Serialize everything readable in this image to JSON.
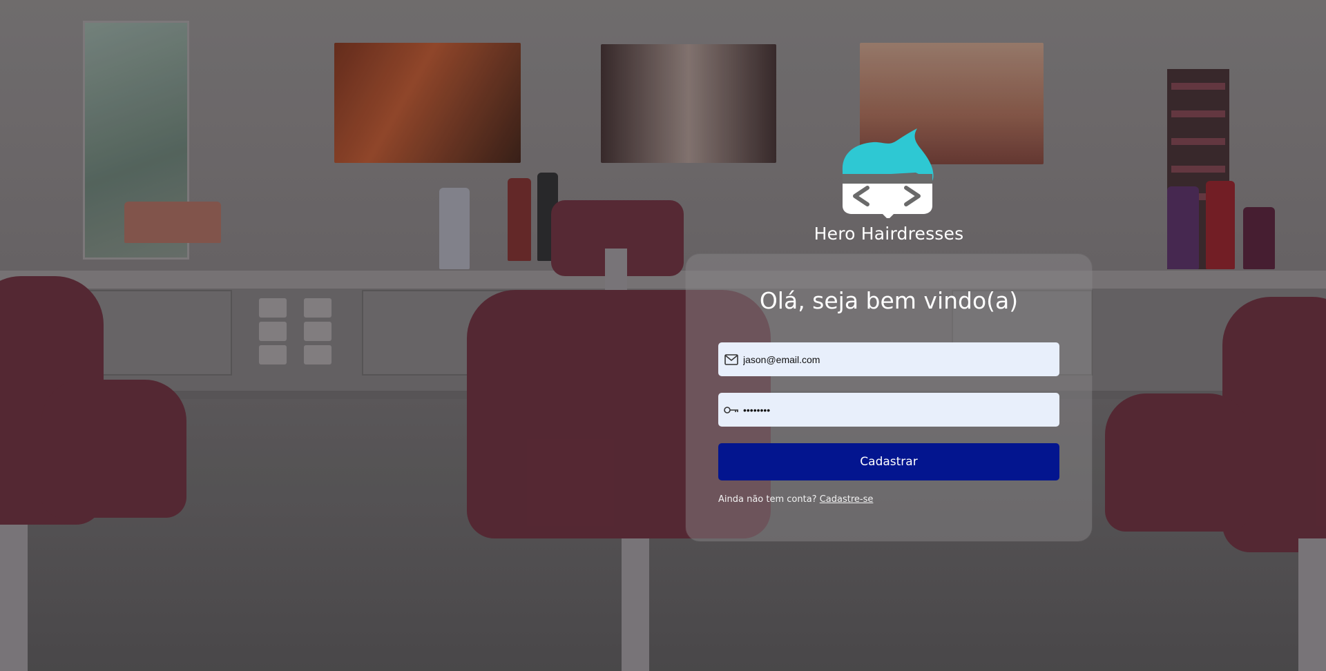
{
  "brand": {
    "name": "Hero Hairdresses",
    "logo_icon": "hero-hair-code-icon",
    "logo_colors": {
      "hair": "#2ec8d3",
      "mask": "#6a6a6a",
      "face": "#ffffff"
    }
  },
  "login": {
    "greeting": "Olá, seja bem vindo(a)",
    "email": {
      "value": "jason@email.com",
      "icon": "mail-icon"
    },
    "password": {
      "value": "••••••••",
      "icon": "key-icon"
    },
    "submit_label": "Cadastrar",
    "signup_prompt": "Ainda não tem conta?",
    "signup_link": "Cadastre-se"
  },
  "colors": {
    "primary_button": "#03158f",
    "input_bg": "#e8effb",
    "text_light": "#ffffff"
  }
}
